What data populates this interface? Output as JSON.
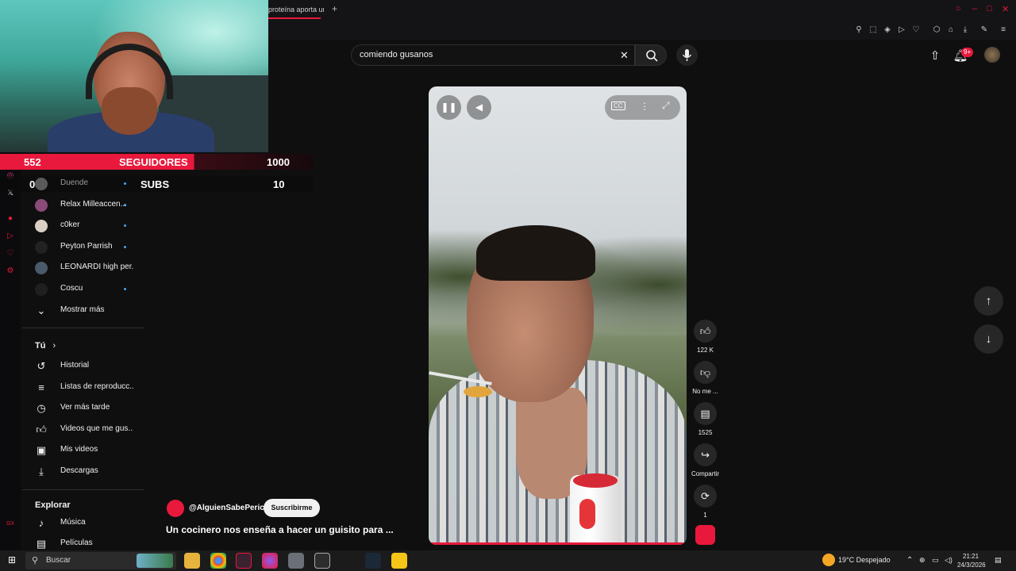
{
  "browser": {
    "tab_title": "proteína aporta un",
    "new_tab": "+"
  },
  "overlay": {
    "followers_count": "552",
    "followers_label": "SEGUIDORES",
    "followers_goal": "1000",
    "subs_count": "0",
    "subs_label": "SUBS",
    "subs_goal": "10"
  },
  "guide": {
    "subscriptions": [
      {
        "label": "Duende",
        "dot": true
      },
      {
        "label": "Relax Milleaccen...",
        "dot": true
      },
      {
        "label": "c0ker",
        "dot": true
      },
      {
        "label": "Peyton Parrish",
        "dot": true
      },
      {
        "label": "LEONARDI high per...",
        "dot": false
      },
      {
        "label": "Coscu",
        "dot": true
      }
    ],
    "show_more": "Mostrar más",
    "you_heading": "Tú",
    "you_items": [
      {
        "label": "Historial",
        "icon": "history-icon"
      },
      {
        "label": "Listas de reproducc...",
        "icon": "playlists-icon"
      },
      {
        "label": "Ver más tarde",
        "icon": "watch-later-icon"
      },
      {
        "label": "Videos que me gus...",
        "icon": "liked-videos-icon"
      },
      {
        "label": "Mis videos",
        "icon": "your-videos-icon"
      },
      {
        "label": "Descargas",
        "icon": "downloads-icon"
      }
    ],
    "explore_heading": "Explorar",
    "explore_items": [
      {
        "label": "Música",
        "icon": "music-icon"
      },
      {
        "label": "Películas",
        "icon": "movies-icon"
      }
    ]
  },
  "search": {
    "value": "comiendo gusanos"
  },
  "notifications": {
    "badge": "9+"
  },
  "short": {
    "channel": "@AlguienSabePerico",
    "subscribe_label": "Suscribirme",
    "title": "Un cocinero nos enseña a hacer un guisito para ...",
    "progress": 1.0,
    "actions": {
      "likes": "122 K",
      "dislike_label": "No me ...",
      "comments": "1525",
      "share_label": "Compartir",
      "remix_count": "1"
    }
  },
  "taskbar": {
    "search_label": "Buscar",
    "weather": "19°C  Despejado",
    "time": "21:21",
    "date": "24/3/2026"
  },
  "colors": {
    "accent": "#e8193c",
    "background": "#0f0f0f",
    "surface": "#272727"
  }
}
